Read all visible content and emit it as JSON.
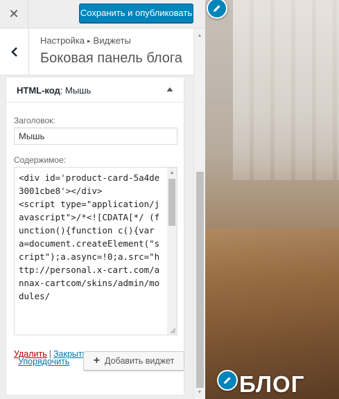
{
  "topbar": {
    "close_icon": "close-icon",
    "publish_label": "Сохранить и опубликовать"
  },
  "panel": {
    "breadcrumb_root": "Настройка",
    "breadcrumb_sep": "▸",
    "breadcrumb_current": "Виджеты",
    "title": "Боковая панель блога",
    "back_icon": "chevron-left-icon"
  },
  "widget": {
    "type_label": "HTML-код",
    "name_suffix": ": Мышь",
    "toggle_icon": "arrow-up-icon",
    "title_label": "Заголовок:",
    "title_value": "Мышь",
    "content_label": "Содержимое:",
    "content_value": "<div id='product-card-5a4de3001cbe8'></div>\n<script type=\"application/javascript\">/*<![CDATA[*/ (function(){function c(){var a=document.createElement(\"script\");a.async=!0;a.src=\"http://personal.x-cart.com/annax-cartcom/skins/admin/modules/",
    "delete_label": "Удалить",
    "actions_separator": "|",
    "close_label": "Закрыть"
  },
  "footer": {
    "reorder_label": "Упорядочить",
    "add_widget_label": "Добавить виджет",
    "add_icon": "plus-icon"
  },
  "preview": {
    "heading": "БЛОГ",
    "edit_icon": "pencil-icon"
  },
  "colors": {
    "accent": "#0085ba",
    "link": "#0073aa",
    "delete": "#aa0000"
  }
}
